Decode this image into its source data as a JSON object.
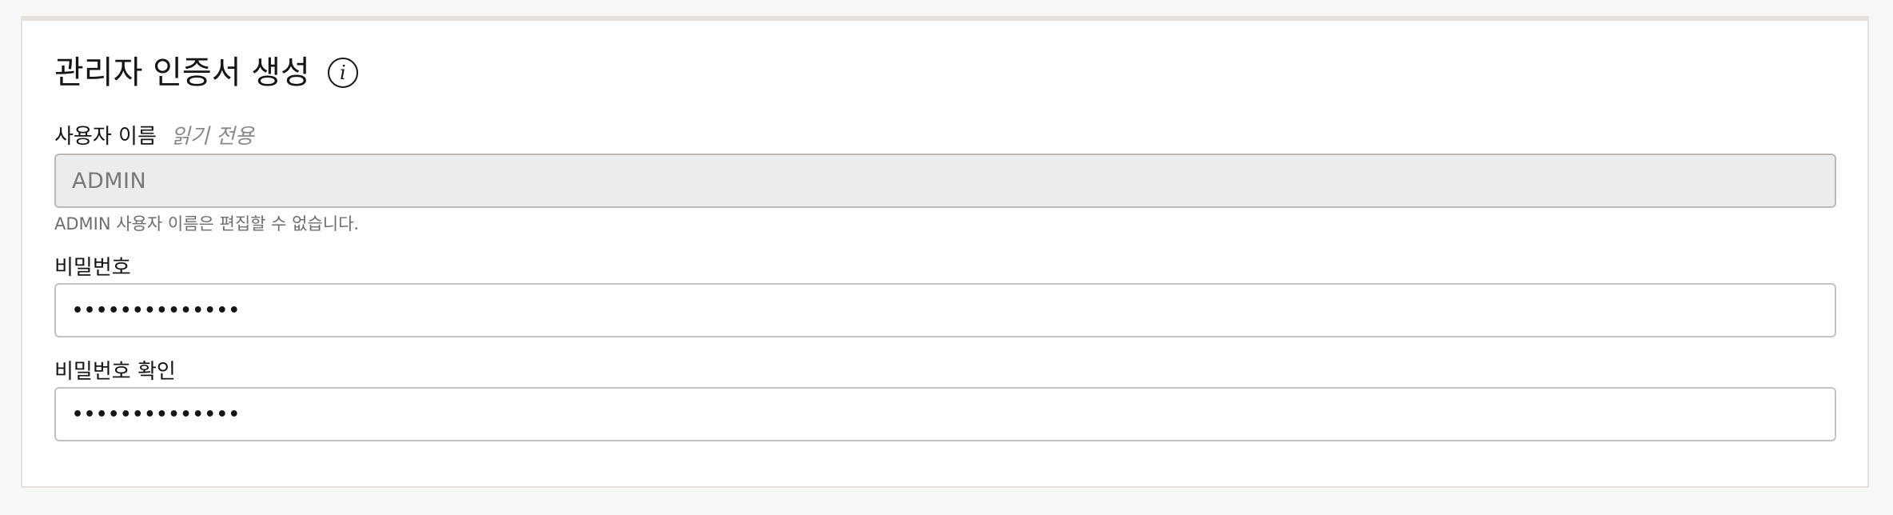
{
  "form": {
    "title": "관리자 인증서 생성",
    "info_glyph": "i",
    "username": {
      "label": "사용자 이름",
      "hint": "읽기 전용",
      "value": "ADMIN",
      "helper": "ADMIN 사용자 이름은 편집할 수 없습니다."
    },
    "password": {
      "label": "비밀번호",
      "masked_value": "••••••••••••••"
    },
    "confirm_password": {
      "label": "비밀번호 확인",
      "masked_value": "••••••••••••••"
    }
  },
  "icons": {
    "info": "info-circle-icon"
  },
  "colors": {
    "text": "#161513",
    "border": "#c4c1be",
    "readonly_bg": "#ececec",
    "helper_text": "#6f6c69",
    "hint_text": "#8a8784"
  }
}
